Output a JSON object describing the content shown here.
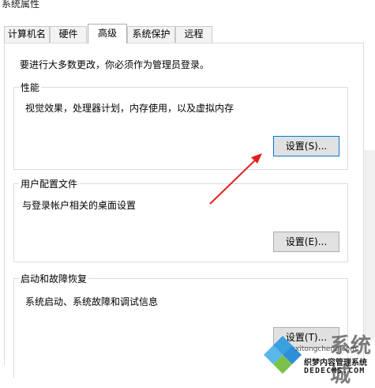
{
  "window": {
    "title": "系统属性"
  },
  "tabs": [
    {
      "label": "计算机名",
      "active": false
    },
    {
      "label": "硬件",
      "active": false
    },
    {
      "label": "高级",
      "active": true
    },
    {
      "label": "系统保护",
      "active": false
    },
    {
      "label": "远程",
      "active": false
    }
  ],
  "notice": "要进行大多数更改，你必须作为管理员登录。",
  "groups": {
    "performance": {
      "title": "性能",
      "description": "视觉效果，处理器计划，内存使用，以及虚拟内存",
      "button": "设置(S)..."
    },
    "user_profiles": {
      "title": "用户配置文件",
      "description": "与登录帐户相关的桌面设置",
      "button": "设置(E)..."
    },
    "startup_recovery": {
      "title": "启动和故障恢复",
      "description": "系统启动、系统故障和调试信息",
      "button": "设置(T)..."
    }
  },
  "annotation": {
    "color": "#e02020"
  },
  "watermark": {
    "url": "xitongcheng.com",
    "cn_text": "织梦内容管理系统",
    "en_text": "DEDECMS.COM",
    "big_text": "系统城"
  }
}
